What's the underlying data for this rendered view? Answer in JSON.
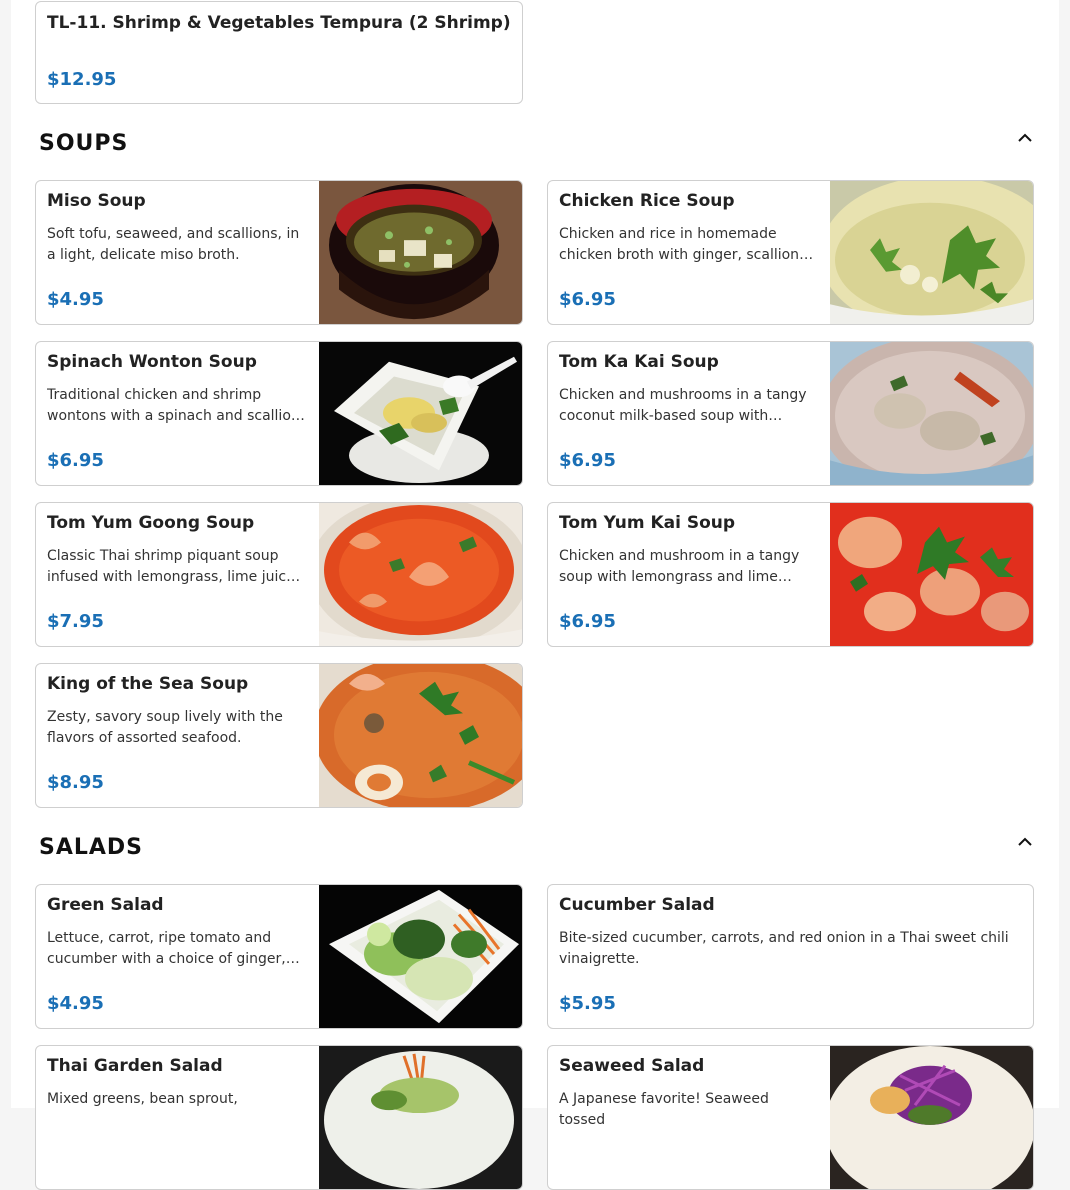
{
  "top_item": {
    "name": "TL-11. Shrimp & Vegetables Tempura (2 Shrimp)",
    "price": "$12.95"
  },
  "soups": {
    "title": "SOUPS",
    "items": [
      {
        "name": "Miso Soup",
        "desc": "Soft tofu, seaweed, and scallions, in a light, delicate miso broth.",
        "price": "$4.95",
        "image": "miso-soup-photo"
      },
      {
        "name": "Chicken Rice Soup",
        "desc": "Chicken and rice in homemade chicken broth with ginger, scallions and cilantro.",
        "price": "$6.95",
        "image": "chicken-rice-soup-photo"
      },
      {
        "name": "Spinach Wonton Soup",
        "desc": "Traditional chicken and shrimp wontons with a spinach and scallion broth.",
        "price": "$6.95",
        "image": "spinach-wonton-soup-photo"
      },
      {
        "name": "Tom Ka Kai Soup",
        "desc": "Chicken and mushrooms in a tangy coconut milk-based soup with lemongrass.",
        "price": "$6.95",
        "image": "tom-ka-kai-soup-photo"
      },
      {
        "name": "Tom Yum Goong Soup",
        "desc": "Classic Thai shrimp piquant soup infused with lemongrass, lime juice and chili.",
        "price": "$7.95",
        "image": "tom-yum-goong-soup-photo"
      },
      {
        "name": "Tom Yum Kai Soup",
        "desc": "Chicken and mushroom in a tangy soup with lemongrass and lime juice.",
        "price": "$6.95",
        "image": "tom-yum-kai-soup-photo"
      },
      {
        "name": "King of the Sea Soup",
        "desc": "Zesty, savory soup lively with the flavors of assorted seafood.",
        "price": "$8.95",
        "image": "king-of-the-sea-soup-photo"
      }
    ]
  },
  "salads": {
    "title": "SALADS",
    "items": [
      {
        "name": "Green Salad",
        "desc": "Lettuce, carrot, ripe tomato and cucumber with a choice of ginger, peanut or house dressing.",
        "price": "$4.95",
        "image": "green-salad-photo"
      },
      {
        "name": "Cucumber Salad",
        "desc": "Bite-sized cucumber, carrots, and red onion in a Thai sweet chili vinaigrette.",
        "price": "$5.95"
      },
      {
        "name": "Thai Garden Salad",
        "desc": "Mixed greens, bean sprout,",
        "price": "",
        "image": "thai-garden-salad-photo"
      },
      {
        "name": "Seaweed Salad",
        "desc": "A Japanese favorite! Seaweed tossed",
        "price": "",
        "image": "seaweed-salad-photo"
      }
    ]
  },
  "icons": {
    "collapse": "chevron-up-icon"
  },
  "colors": {
    "price": "#1a6fb5",
    "border": "#cfcfcf"
  }
}
